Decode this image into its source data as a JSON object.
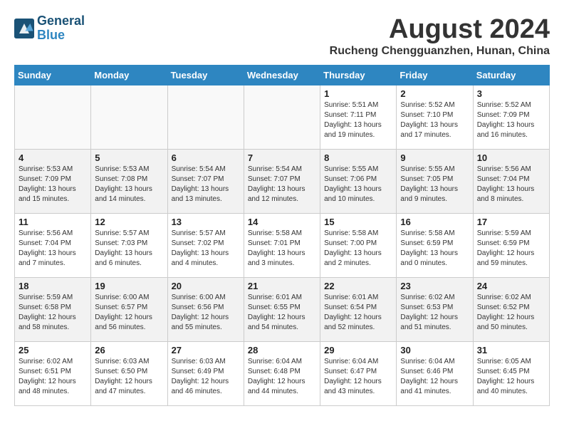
{
  "logo": {
    "line1": "General",
    "line2": "Blue"
  },
  "title": "August 2024",
  "location": "Rucheng Chengguanzhen, Hunan, China",
  "days_of_week": [
    "Sunday",
    "Monday",
    "Tuesday",
    "Wednesday",
    "Thursday",
    "Friday",
    "Saturday"
  ],
  "weeks": [
    [
      {
        "num": "",
        "info": ""
      },
      {
        "num": "",
        "info": ""
      },
      {
        "num": "",
        "info": ""
      },
      {
        "num": "",
        "info": ""
      },
      {
        "num": "1",
        "info": "Sunrise: 5:51 AM\nSunset: 7:11 PM\nDaylight: 13 hours\nand 19 minutes."
      },
      {
        "num": "2",
        "info": "Sunrise: 5:52 AM\nSunset: 7:10 PM\nDaylight: 13 hours\nand 17 minutes."
      },
      {
        "num": "3",
        "info": "Sunrise: 5:52 AM\nSunset: 7:09 PM\nDaylight: 13 hours\nand 16 minutes."
      }
    ],
    [
      {
        "num": "4",
        "info": "Sunrise: 5:53 AM\nSunset: 7:09 PM\nDaylight: 13 hours\nand 15 minutes."
      },
      {
        "num": "5",
        "info": "Sunrise: 5:53 AM\nSunset: 7:08 PM\nDaylight: 13 hours\nand 14 minutes."
      },
      {
        "num": "6",
        "info": "Sunrise: 5:54 AM\nSunset: 7:07 PM\nDaylight: 13 hours\nand 13 minutes."
      },
      {
        "num": "7",
        "info": "Sunrise: 5:54 AM\nSunset: 7:07 PM\nDaylight: 13 hours\nand 12 minutes."
      },
      {
        "num": "8",
        "info": "Sunrise: 5:55 AM\nSunset: 7:06 PM\nDaylight: 13 hours\nand 10 minutes."
      },
      {
        "num": "9",
        "info": "Sunrise: 5:55 AM\nSunset: 7:05 PM\nDaylight: 13 hours\nand 9 minutes."
      },
      {
        "num": "10",
        "info": "Sunrise: 5:56 AM\nSunset: 7:04 PM\nDaylight: 13 hours\nand 8 minutes."
      }
    ],
    [
      {
        "num": "11",
        "info": "Sunrise: 5:56 AM\nSunset: 7:04 PM\nDaylight: 13 hours\nand 7 minutes."
      },
      {
        "num": "12",
        "info": "Sunrise: 5:57 AM\nSunset: 7:03 PM\nDaylight: 13 hours\nand 6 minutes."
      },
      {
        "num": "13",
        "info": "Sunrise: 5:57 AM\nSunset: 7:02 PM\nDaylight: 13 hours\nand 4 minutes."
      },
      {
        "num": "14",
        "info": "Sunrise: 5:58 AM\nSunset: 7:01 PM\nDaylight: 13 hours\nand 3 minutes."
      },
      {
        "num": "15",
        "info": "Sunrise: 5:58 AM\nSunset: 7:00 PM\nDaylight: 13 hours\nand 2 minutes."
      },
      {
        "num": "16",
        "info": "Sunrise: 5:58 AM\nSunset: 6:59 PM\nDaylight: 13 hours\nand 0 minutes."
      },
      {
        "num": "17",
        "info": "Sunrise: 5:59 AM\nSunset: 6:59 PM\nDaylight: 12 hours\nand 59 minutes."
      }
    ],
    [
      {
        "num": "18",
        "info": "Sunrise: 5:59 AM\nSunset: 6:58 PM\nDaylight: 12 hours\nand 58 minutes."
      },
      {
        "num": "19",
        "info": "Sunrise: 6:00 AM\nSunset: 6:57 PM\nDaylight: 12 hours\nand 56 minutes."
      },
      {
        "num": "20",
        "info": "Sunrise: 6:00 AM\nSunset: 6:56 PM\nDaylight: 12 hours\nand 55 minutes."
      },
      {
        "num": "21",
        "info": "Sunrise: 6:01 AM\nSunset: 6:55 PM\nDaylight: 12 hours\nand 54 minutes."
      },
      {
        "num": "22",
        "info": "Sunrise: 6:01 AM\nSunset: 6:54 PM\nDaylight: 12 hours\nand 52 minutes."
      },
      {
        "num": "23",
        "info": "Sunrise: 6:02 AM\nSunset: 6:53 PM\nDaylight: 12 hours\nand 51 minutes."
      },
      {
        "num": "24",
        "info": "Sunrise: 6:02 AM\nSunset: 6:52 PM\nDaylight: 12 hours\nand 50 minutes."
      }
    ],
    [
      {
        "num": "25",
        "info": "Sunrise: 6:02 AM\nSunset: 6:51 PM\nDaylight: 12 hours\nand 48 minutes."
      },
      {
        "num": "26",
        "info": "Sunrise: 6:03 AM\nSunset: 6:50 PM\nDaylight: 12 hours\nand 47 minutes."
      },
      {
        "num": "27",
        "info": "Sunrise: 6:03 AM\nSunset: 6:49 PM\nDaylight: 12 hours\nand 46 minutes."
      },
      {
        "num": "28",
        "info": "Sunrise: 6:04 AM\nSunset: 6:48 PM\nDaylight: 12 hours\nand 44 minutes."
      },
      {
        "num": "29",
        "info": "Sunrise: 6:04 AM\nSunset: 6:47 PM\nDaylight: 12 hours\nand 43 minutes."
      },
      {
        "num": "30",
        "info": "Sunrise: 6:04 AM\nSunset: 6:46 PM\nDaylight: 12 hours\nand 41 minutes."
      },
      {
        "num": "31",
        "info": "Sunrise: 6:05 AM\nSunset: 6:45 PM\nDaylight: 12 hours\nand 40 minutes."
      }
    ]
  ]
}
